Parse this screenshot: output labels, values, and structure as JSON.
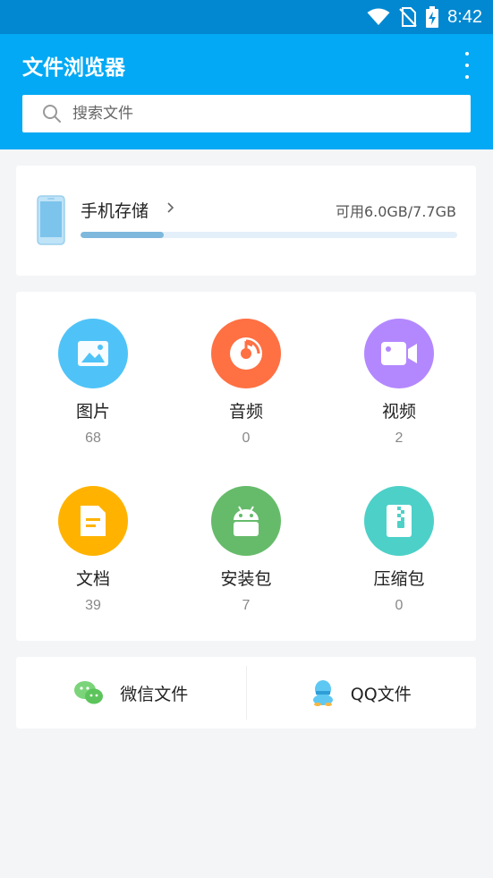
{
  "status_bar": {
    "time": "8:42"
  },
  "app_bar": {
    "title": "文件浏览器"
  },
  "search": {
    "placeholder": "搜索文件"
  },
  "storage": {
    "title": "手机存储",
    "available_text": "可用6.0GB/7.7GB",
    "used_fraction": 0.22
  },
  "categories": [
    {
      "label": "图片",
      "count": "68",
      "icon": "image-icon",
      "color": "#4fc3f7"
    },
    {
      "label": "音频",
      "count": "0",
      "icon": "music-disc-icon",
      "color": "#ff7043"
    },
    {
      "label": "视频",
      "count": "2",
      "icon": "video-camera-icon",
      "color": "#b388ff"
    },
    {
      "label": "文档",
      "count": "39",
      "icon": "document-icon",
      "color": "#ffb300"
    },
    {
      "label": "安装包",
      "count": "7",
      "icon": "android-icon",
      "color": "#66bb6a"
    },
    {
      "label": "压缩包",
      "count": "0",
      "icon": "zip-icon",
      "color": "#4dd0c8"
    }
  ],
  "quick": {
    "wechat": {
      "label": "微信文件",
      "icon": "wechat-icon"
    },
    "qq": {
      "label": "QQ文件",
      "icon": "qq-icon"
    }
  }
}
